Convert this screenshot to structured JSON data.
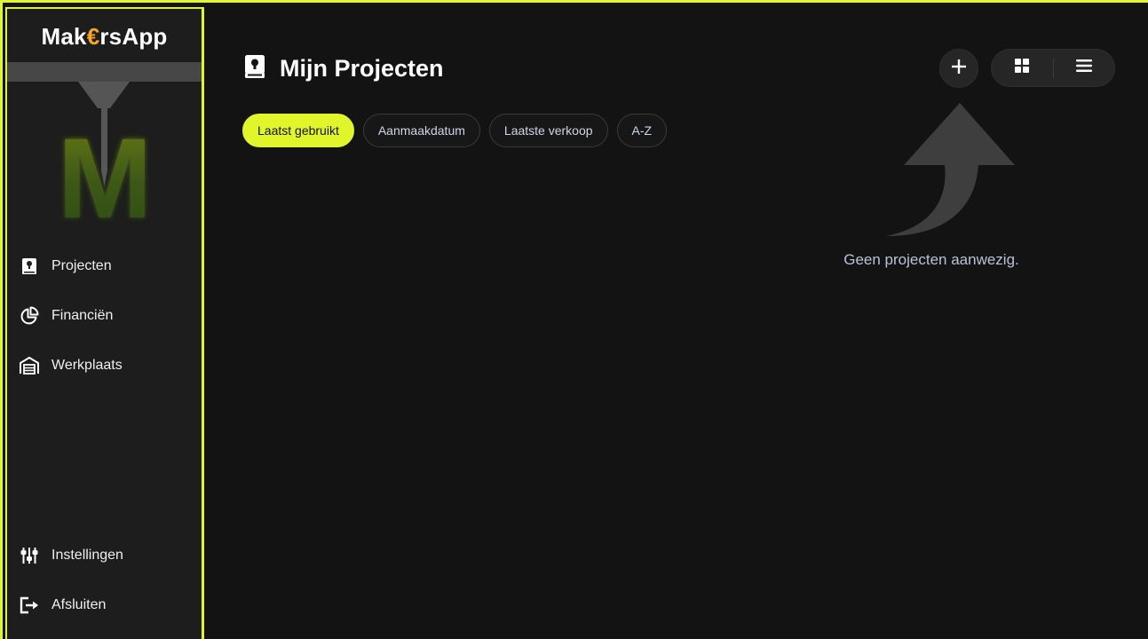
{
  "app": {
    "brand_prefix": "Mak",
    "brand_symbol": "€",
    "brand_suffix": "rsApp",
    "accent_color": "#e0f52a"
  },
  "sidebar": {
    "items": [
      {
        "label": "Projecten",
        "icon": "project-book-icon"
      },
      {
        "label": "Financiën",
        "icon": "pie-chart-icon"
      },
      {
        "label": "Werkplaats",
        "icon": "warehouse-icon"
      }
    ],
    "bottom_items": [
      {
        "label": "Instellingen",
        "icon": "sliders-icon"
      },
      {
        "label": "Afsluiten",
        "icon": "logout-icon"
      }
    ]
  },
  "main": {
    "title": "Mijn Projecten",
    "title_icon": "project-book-icon",
    "filters": [
      {
        "label": "Laatst gebruikt",
        "active": true
      },
      {
        "label": "Aanmaakdatum",
        "active": false
      },
      {
        "label": "Laatste verkoop",
        "active": false
      },
      {
        "label": "A-Z",
        "active": false
      }
    ],
    "actions": {
      "add_icon": "plus-icon",
      "grid_icon": "grid-view-icon",
      "list_icon": "list-view-icon"
    },
    "empty_state": {
      "message": "Geen projecten aanwezig.",
      "icon": "curved-arrow-up-icon"
    }
  }
}
